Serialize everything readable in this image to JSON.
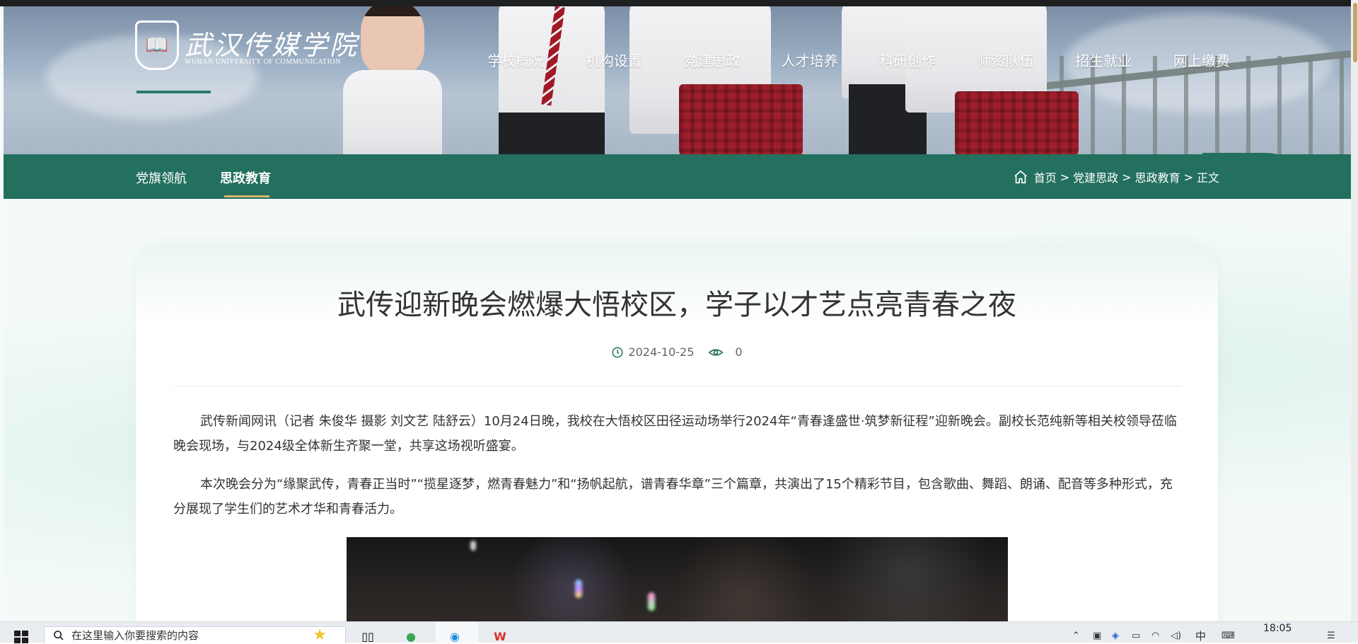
{
  "site": {
    "logo_name": "武汉传媒学院",
    "logo_sub": "WUHAN UNIVERSITY OF COMMUNICATION",
    "logo_emblem": "📖"
  },
  "main_nav": [
    "学校概况",
    "机构设置",
    "党建思政",
    "人才培养",
    "科研创作",
    "师资队伍",
    "招生就业",
    "网上缴费"
  ],
  "sub_nav": {
    "items": [
      "党旗领航",
      "思政教育"
    ],
    "active_index": 1
  },
  "breadcrumb": {
    "home": "首页",
    "separator": ">",
    "level1": "党建思政",
    "level2": "思政教育",
    "current": "正文"
  },
  "article": {
    "title": "武传迎新晚会燃爆大悟校区，学子以才艺点亮青春之夜",
    "date": "2024-10-25",
    "views": "0",
    "paragraphs": [
      "武传新闻网讯（记者 朱俊华 摄影 刘文艺 陆舒云）10月24日晚，我校在大悟校区田径运动场举行2024年“青春逢盛世·筑梦新征程”迎新晚会。副校长范纯新等相关校领导莅临晚会现场，与2024级全体新生齐聚一堂，共享这场视听盛宴。",
      "本次晚会分为“缘聚武传，青春正当时”“揽星逐梦，燃青春魅力”和“扬帆起航，谱青春华章”三个篇章，共演出了15个精彩节目，包含歌曲、舞蹈、朗诵、配音等多种形式，充分展现了学生们的艺术才华和青春活力。"
    ]
  },
  "taskbar": {
    "search_placeholder": "在这里输入你要搜索的内容",
    "time": "18:05",
    "ime": "中"
  },
  "colors": {
    "brand_green": "#23705f",
    "accent_gold": "#d8b36e",
    "text_dark": "#333333"
  }
}
